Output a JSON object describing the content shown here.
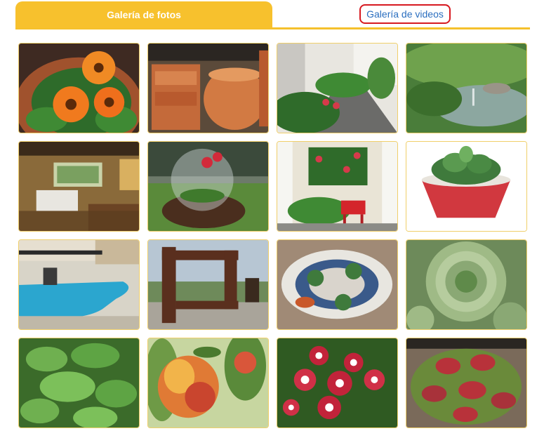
{
  "tabs": {
    "photos_label": "Galería de fotos",
    "videos_label": "Galería de videos"
  },
  "colors": {
    "accent": "#f7c12d",
    "link": "#2a6ebf",
    "highlight_border": "#d71920"
  },
  "gallery": {
    "images": [
      {
        "subject": "orange-gerbera-flowers"
      },
      {
        "subject": "terracotta-pots"
      },
      {
        "subject": "garden-path-planting"
      },
      {
        "subject": "pond-garden"
      },
      {
        "subject": "covered-terrace"
      },
      {
        "subject": "glass-terrarium"
      },
      {
        "subject": "vertical-garden-red-chair"
      },
      {
        "subject": "succulent-red-bowl"
      },
      {
        "subject": "pool-garden"
      },
      {
        "subject": "wooden-frame-view"
      },
      {
        "subject": "stone-mosaic-garden"
      },
      {
        "subject": "sempervivum-succulent"
      },
      {
        "subject": "mint-plant"
      },
      {
        "subject": "peach-fruit"
      },
      {
        "subject": "dianthus-flowers"
      },
      {
        "subject": "venus-flytrap"
      }
    ]
  }
}
